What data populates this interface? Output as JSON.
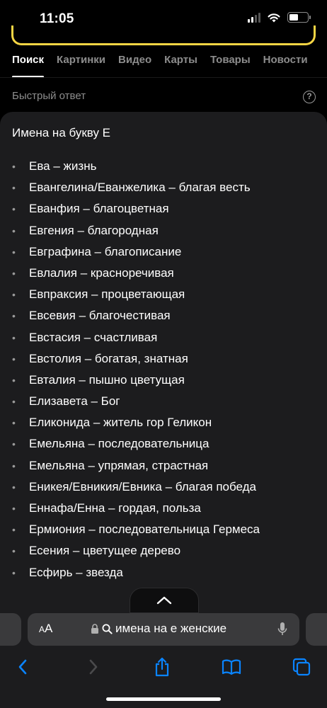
{
  "status_bar": {
    "time": "11:05"
  },
  "tabs": [
    {
      "label": "Поиск",
      "active": true
    },
    {
      "label": "Картинки",
      "active": false
    },
    {
      "label": "Видео",
      "active": false
    },
    {
      "label": "Карты",
      "active": false
    },
    {
      "label": "Товары",
      "active": false
    },
    {
      "label": "Новости",
      "active": false
    }
  ],
  "quick_answer": {
    "label": "Быстрый ответ",
    "help_icon": "question-circle-icon"
  },
  "card": {
    "title": "Имена на букву Е",
    "items": [
      "Ева – жизнь",
      "Евангелина/Еванжелика – благая весть",
      "Еванфия – благоцветная",
      "Евгения – благородная",
      "Евграфина – благописание",
      "Евлалия – красноречивая",
      "Евпраксия – процветающая",
      "Евсевия – благочестивая",
      "Евстасия – счастливая",
      "Евстолия – богатая, знатная",
      "Евталия – пышно цветущая",
      "Елизавета – Бог",
      "Еликонида – житель гор Геликон",
      "Емельяна – последовательница",
      "Емельяна – упрямая, страстная",
      "Еникея/Евникия/Евника – благая победа",
      "Еннафа/Енна – гордая, польза",
      "Ермиония – последовательница Гермеса",
      "Есения – цветущее дерево",
      "Есфирь – звезда"
    ]
  },
  "address_bar": {
    "aa_small": "A",
    "aa_large": "A",
    "query": "имена на е женские"
  },
  "colors": {
    "accent_yellow": "#f5d544",
    "link_blue": "#0a84ff",
    "card_bg": "#1c1c1e",
    "muted_text": "#8d8d8d"
  }
}
